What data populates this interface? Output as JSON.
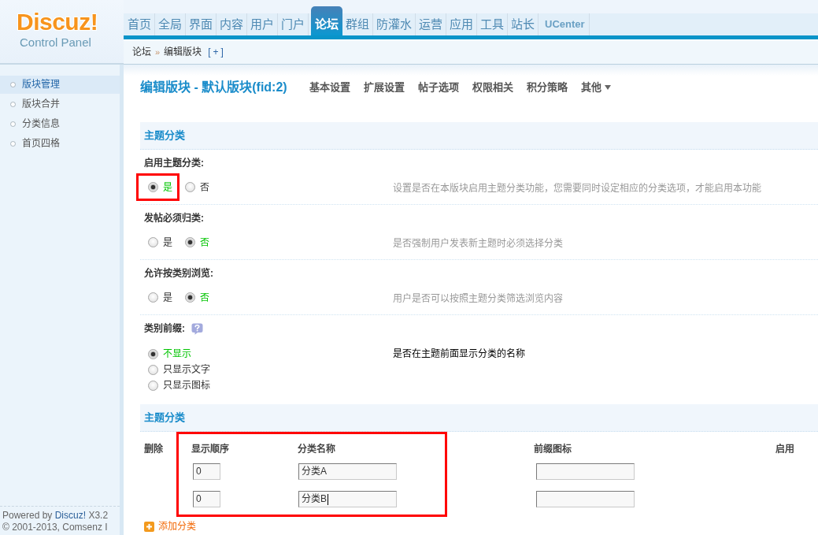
{
  "logo": {
    "title": "Discuz!",
    "subtitle": "Control Panel"
  },
  "top_nav": [
    {
      "label": "首页",
      "selected": false,
      "kind": "menu"
    },
    {
      "label": "全局",
      "selected": false,
      "kind": "menu"
    },
    {
      "label": "界面",
      "selected": false,
      "kind": "menu"
    },
    {
      "label": "内容",
      "selected": false,
      "kind": "menu"
    },
    {
      "label": "用户",
      "selected": false,
      "kind": "menu"
    },
    {
      "label": "门户",
      "selected": false,
      "kind": "menu"
    },
    {
      "label": "论坛",
      "selected": true,
      "kind": "menu"
    },
    {
      "label": "群组",
      "selected": false,
      "kind": "menu"
    },
    {
      "label": "防灌水",
      "selected": false,
      "kind": "menu"
    },
    {
      "label": "运营",
      "selected": false,
      "kind": "menu"
    },
    {
      "label": "应用",
      "selected": false,
      "kind": "menu"
    },
    {
      "label": "工具",
      "selected": false,
      "kind": "menu"
    },
    {
      "label": "站长",
      "selected": false,
      "kind": "menu"
    },
    {
      "label": "UCenter",
      "selected": false,
      "kind": "app"
    }
  ],
  "breadcrumb": [
    {
      "kind": "link",
      "text": "论坛"
    },
    {
      "kind": "separator",
      "text": "»"
    },
    {
      "kind": "current",
      "text": "编辑版块"
    },
    {
      "kind": "action",
      "text": "[+]"
    }
  ],
  "sidebar": {
    "items": [
      {
        "label": "版块管理",
        "selected": true
      },
      {
        "label": "版块合并",
        "selected": false
      },
      {
        "label": "分类信息",
        "selected": false
      },
      {
        "label": "首页四格",
        "selected": false
      }
    ],
    "footer": {
      "prefix": "Powered by",
      "link": "Discuz!",
      "suffix": "X3.2",
      "copyright": "© 2001-2013, Comsenz I"
    }
  },
  "page_title": "编辑版块 - 默认版块(fid:2)",
  "sub_tabs": [
    {
      "label": "基本设置",
      "dropdown": false
    },
    {
      "label": "扩展设置",
      "dropdown": false
    },
    {
      "label": "帖子选项",
      "dropdown": false
    },
    {
      "label": "权限相关",
      "dropdown": false
    },
    {
      "label": "积分策略",
      "dropdown": false
    },
    {
      "label": "其他",
      "dropdown": true
    }
  ],
  "section_1": {
    "title": "主题分类",
    "settings": [
      {
        "label": "启用主题分类:",
        "help": false,
        "kind": "inline",
        "options": [
          {
            "label": "是",
            "selected": true,
            "highlighted": true
          },
          {
            "label": "否",
            "selected": false,
            "highlighted": false
          }
        ],
        "description": "设置是否在本版块启用主题分类功能，您需要同时设定相应的分类选项，才能启用本功能"
      },
      {
        "label": "发帖必须归类:",
        "help": false,
        "kind": "inline",
        "options": [
          {
            "label": "是",
            "selected": false,
            "highlighted": false
          },
          {
            "label": "否",
            "selected": true,
            "highlighted": false
          }
        ],
        "description": "是否强制用户发表新主题时必须选择分类"
      },
      {
        "label": "允许按类别浏览:",
        "help": false,
        "kind": "inline",
        "options": [
          {
            "label": "是",
            "selected": false,
            "highlighted": false
          },
          {
            "label": "否",
            "selected": true,
            "highlighted": false
          }
        ],
        "description": "用户是否可以按照主题分类筛选浏览内容"
      },
      {
        "label": "类别前缀:",
        "help": true,
        "kind": "stacked",
        "options": [
          {
            "label": "不显示",
            "selected": true,
            "highlighted": false
          },
          {
            "label": "只显示文字",
            "selected": false,
            "highlighted": false
          },
          {
            "label": "只显示图标",
            "selected": false,
            "highlighted": false
          }
        ],
        "description": "是否在主题前面显示分类的名称"
      }
    ]
  },
  "section_2": {
    "title": "主题分类",
    "table": {
      "columns": [
        {
          "label": "删除",
          "kind": "delete",
          "highlighted": false
        },
        {
          "label": "显示顺序",
          "kind": "order",
          "highlighted": true
        },
        {
          "label": "分类名称",
          "kind": "name",
          "highlighted": true
        },
        {
          "label": "前缀图标",
          "kind": "icon",
          "highlighted": false
        },
        {
          "label": "启用",
          "kind": "enable",
          "highlighted": false
        }
      ],
      "rows": [
        {
          "order": "0",
          "name": "分类A",
          "focused": false
        },
        {
          "order": "0",
          "name": "分类B",
          "focused": true
        }
      ]
    },
    "add_link": "添加分类"
  }
}
